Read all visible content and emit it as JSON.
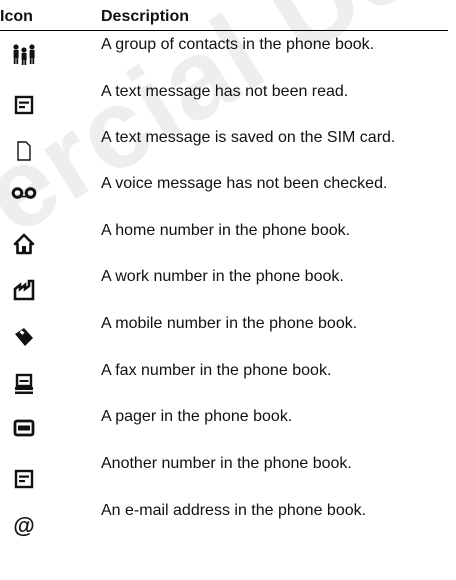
{
  "watermark": "ercial Use",
  "table": {
    "headers": {
      "icon": "Icon",
      "description": "Description"
    },
    "rows": [
      {
        "icon": "contacts-group-icon",
        "description": "A group of contacts in the phone book."
      },
      {
        "icon": "unread-message-icon",
        "description": "A text message has not been read."
      },
      {
        "icon": "sim-card-icon",
        "description": "A text message is saved on the SIM card."
      },
      {
        "icon": "voicemail-icon",
        "description": "A voice message has not been checked."
      },
      {
        "icon": "home-icon",
        "description": "A home number in the phone book."
      },
      {
        "icon": "work-factory-icon",
        "description": "A work number in the phone book."
      },
      {
        "icon": "mobile-phone-icon",
        "description": "A mobile number in the phone book."
      },
      {
        "icon": "fax-icon",
        "description": "A fax number in the phone book."
      },
      {
        "icon": "pager-icon",
        "description": "A pager in the phone book."
      },
      {
        "icon": "other-number-icon",
        "description": "Another number in the phone book."
      },
      {
        "icon": "email-at-icon",
        "description": "An e-mail address in the phone book."
      }
    ]
  }
}
